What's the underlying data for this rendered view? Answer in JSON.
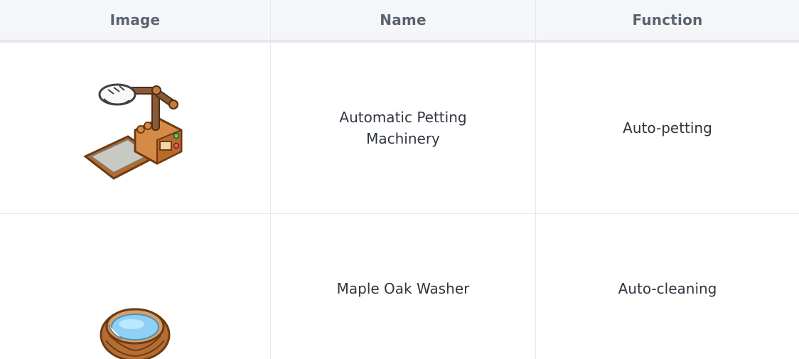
{
  "table": {
    "headers": [
      "Image",
      "Name",
      "Function"
    ],
    "rows": [
      {
        "icon": "automatic-petting-machinery-icon",
        "name": "Automatic Petting Machinery",
        "function": "Auto-petting"
      },
      {
        "icon": "maple-oak-washer-icon",
        "name": "Maple Oak Washer",
        "function": "Auto-cleaning"
      }
    ]
  },
  "colors": {
    "header_bg": "#f5f6f8",
    "border": "#e6e8ec",
    "header_text": "#59636f",
    "body_text": "#2f3640",
    "wood": "#c8843f",
    "water": "#8fd0f5"
  }
}
